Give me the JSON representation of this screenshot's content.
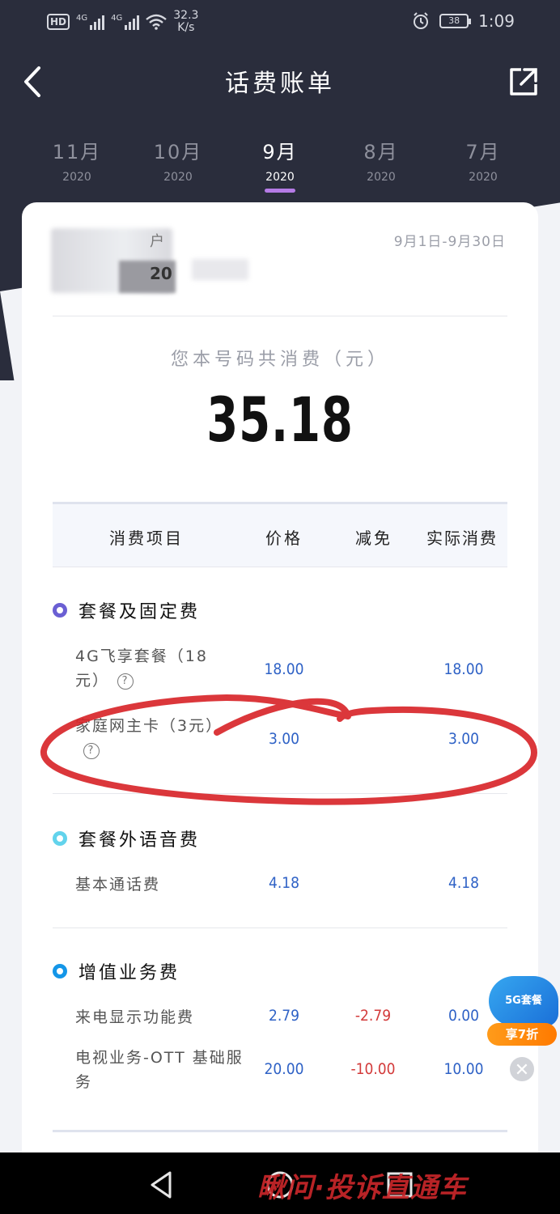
{
  "status_bar": {
    "hd": "HD",
    "signal_1": "4G",
    "signal_2": "4G",
    "speed_value": "32.3",
    "speed_unit": "K/s",
    "battery": "38",
    "time": "1:09"
  },
  "header": {
    "title": "话费账单"
  },
  "months": [
    {
      "month": "11月",
      "year": "2020",
      "active": false
    },
    {
      "month": "10月",
      "year": "2020",
      "active": false
    },
    {
      "month": "9月",
      "year": "2020",
      "active": true
    },
    {
      "month": "8月",
      "year": "2020",
      "active": false
    },
    {
      "month": "7月",
      "year": "2020",
      "active": false
    }
  ],
  "bill": {
    "account_fragment": "户",
    "number_fragment": "20",
    "period": "9月1日-9月30日",
    "total_label": "您本号码共消费（元）",
    "total_value": "35.18"
  },
  "table": {
    "headers": [
      "消费项目",
      "价格",
      "减免",
      "实际消费"
    ],
    "sections": [
      {
        "title": "套餐及固定费",
        "color": "#6a5fd3",
        "rows": [
          {
            "name": "4G飞享套餐（18元）",
            "price": "18.00",
            "discount": "",
            "actual": "18.00",
            "help": "?"
          },
          {
            "name": "家庭网主卡（3元）",
            "price": "3.00",
            "discount": "",
            "actual": "3.00",
            "help": "?"
          }
        ]
      },
      {
        "title": "套餐外语音费",
        "color": "#62d3ec",
        "rows": [
          {
            "name": "基本通话费",
            "price": "4.18",
            "discount": "",
            "actual": "4.18"
          }
        ]
      },
      {
        "title": "增值业务费",
        "color": "#1496e8",
        "rows": [
          {
            "name": "来电显示功能费",
            "price": "2.79",
            "discount": "-2.79",
            "actual": "0.00"
          },
          {
            "name": "电视业务-OTT 基础服务",
            "price": "20.00",
            "discount": "-10.00",
            "actual": "10.00"
          }
        ]
      }
    ]
  },
  "promo": {
    "badge": "5G套餐",
    "tag": "享7折",
    "close": "✕"
  },
  "watermark": "瞅问·投诉直通车",
  "colors": {
    "header_bg": "#2a2d3c",
    "accent_tab": "#b57be6",
    "value_blue": "#2f62c6",
    "value_red": "#d33b3b",
    "scribble_red": "#d8262a"
  }
}
